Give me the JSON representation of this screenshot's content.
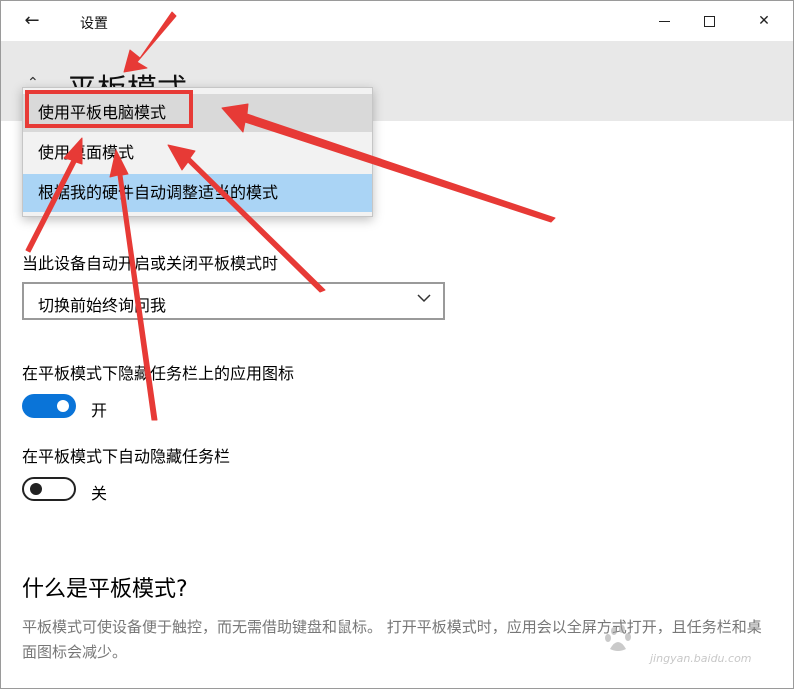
{
  "window": {
    "title": "设置",
    "back_icon": "back-arrow-icon",
    "close_glyph": "✕"
  },
  "page": {
    "title": "平板模式",
    "home_icon": "home-icon"
  },
  "dropdown_menu": {
    "items": [
      "使用平板电脑模式",
      "使用桌面模式",
      "根据我的硬件自动调整适当的模式"
    ],
    "selected_index": 2,
    "highlight_color": "#aad4f5"
  },
  "auto_switch": {
    "label": "当此设备自动开启或关闭平板模式时",
    "value": "切换前始终询问我"
  },
  "hide_icons": {
    "label": "在平板模式下隐藏任务栏上的应用图标",
    "state": "开",
    "on": true
  },
  "hide_taskbar": {
    "label": "在平板模式下自动隐藏任务栏",
    "state": "关",
    "on": false
  },
  "about": {
    "heading": "什么是平板模式?",
    "description": "平板模式可使设备便于触控，而无需借助键盘和鼠标。 打开平板模式时，应用会以全屏方式打开，且任务栏和桌面图标会减少。"
  },
  "watermark": {
    "text": "jingyan.baidu.com"
  },
  "colors": {
    "accent": "#0a74d8",
    "annotation": "#e73a36"
  }
}
